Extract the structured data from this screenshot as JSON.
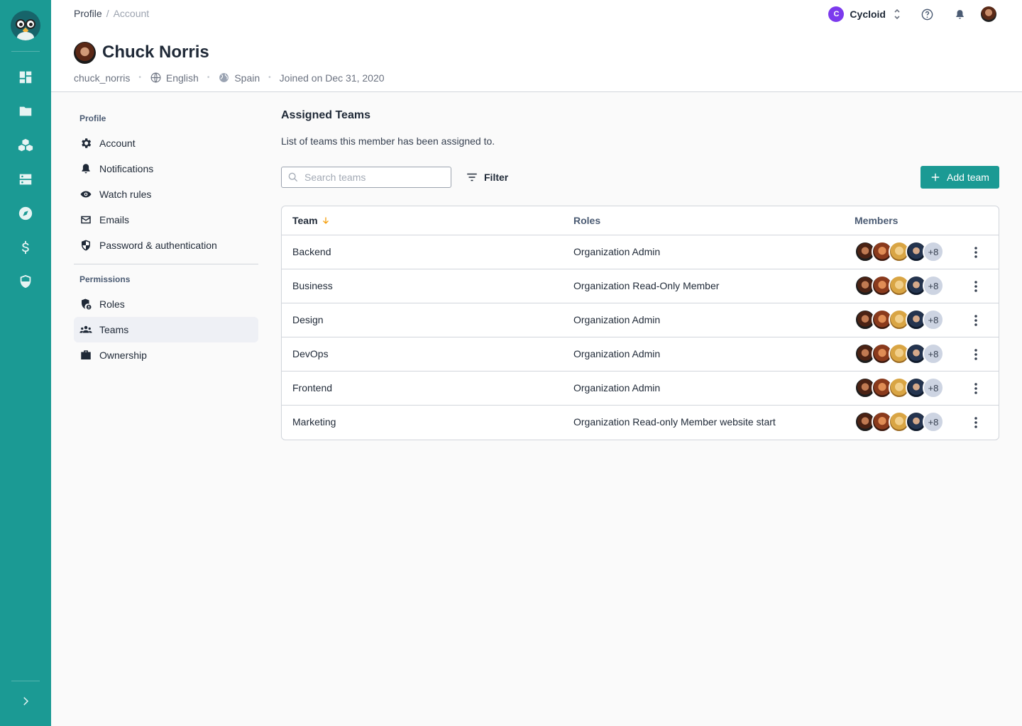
{
  "colors": {
    "brand": "#1b9a94",
    "org_badge": "#7c3aed",
    "sort_arrow": "#f59e0b"
  },
  "rail": {
    "logo_icon": "owl-logo-icon",
    "items": [
      {
        "icon": "dashboard-icon"
      },
      {
        "icon": "folder-icon"
      },
      {
        "icon": "cubes-icon"
      },
      {
        "icon": "servers-icon"
      },
      {
        "icon": "compass-icon"
      },
      {
        "icon": "dollar-icon"
      },
      {
        "icon": "shield-icon"
      }
    ],
    "collapse_icon": "chevron-right-icon"
  },
  "breadcrumb": {
    "first": "Profile",
    "separator": "/",
    "current": "Account"
  },
  "org": {
    "badge": "C",
    "name": "Cycloid"
  },
  "user": {
    "name": "Chuck Norris",
    "username": "chuck_norris",
    "language": "English",
    "country": "Spain",
    "joined": "Joined on Dec 31, 2020"
  },
  "profile_nav": {
    "profile_title": "Profile",
    "profile_items": [
      {
        "label": "Account",
        "icon": "gear-icon"
      },
      {
        "label": "Notifications",
        "icon": "bell-icon"
      },
      {
        "label": "Watch rules",
        "icon": "eye-icon"
      },
      {
        "label": "Emails",
        "icon": "mail-icon"
      },
      {
        "label": "Password & authentication",
        "icon": "shield-lock-icon"
      }
    ],
    "permissions_title": "Permissions",
    "permission_items": [
      {
        "label": "Roles",
        "icon": "roles-icon"
      },
      {
        "label": "Teams",
        "icon": "people-icon",
        "active": true
      },
      {
        "label": "Ownership",
        "icon": "briefcase-icon"
      }
    ]
  },
  "main": {
    "title": "Assigned Teams",
    "description": "List of teams this member has been assigned to.",
    "search_placeholder": "Search teams",
    "filter_label": "Filter",
    "add_label": "Add team",
    "table": {
      "headers": {
        "team": "Team",
        "roles": "Roles",
        "members": "Members"
      },
      "rows": [
        {
          "team": "Backend",
          "role": "Organization Admin",
          "more": "+8"
        },
        {
          "team": "Business",
          "role": "Organization Read-Only Member",
          "more": "+8"
        },
        {
          "team": "Design",
          "role": "Organization Admin",
          "more": "+8"
        },
        {
          "team": "DevOps",
          "role": "Organization Admin",
          "more": "+8"
        },
        {
          "team": "Frontend",
          "role": "Organization Admin",
          "more": "+8"
        },
        {
          "team": "Marketing",
          "role": "Organization Read-only Member website start",
          "more": "+8"
        }
      ]
    }
  }
}
